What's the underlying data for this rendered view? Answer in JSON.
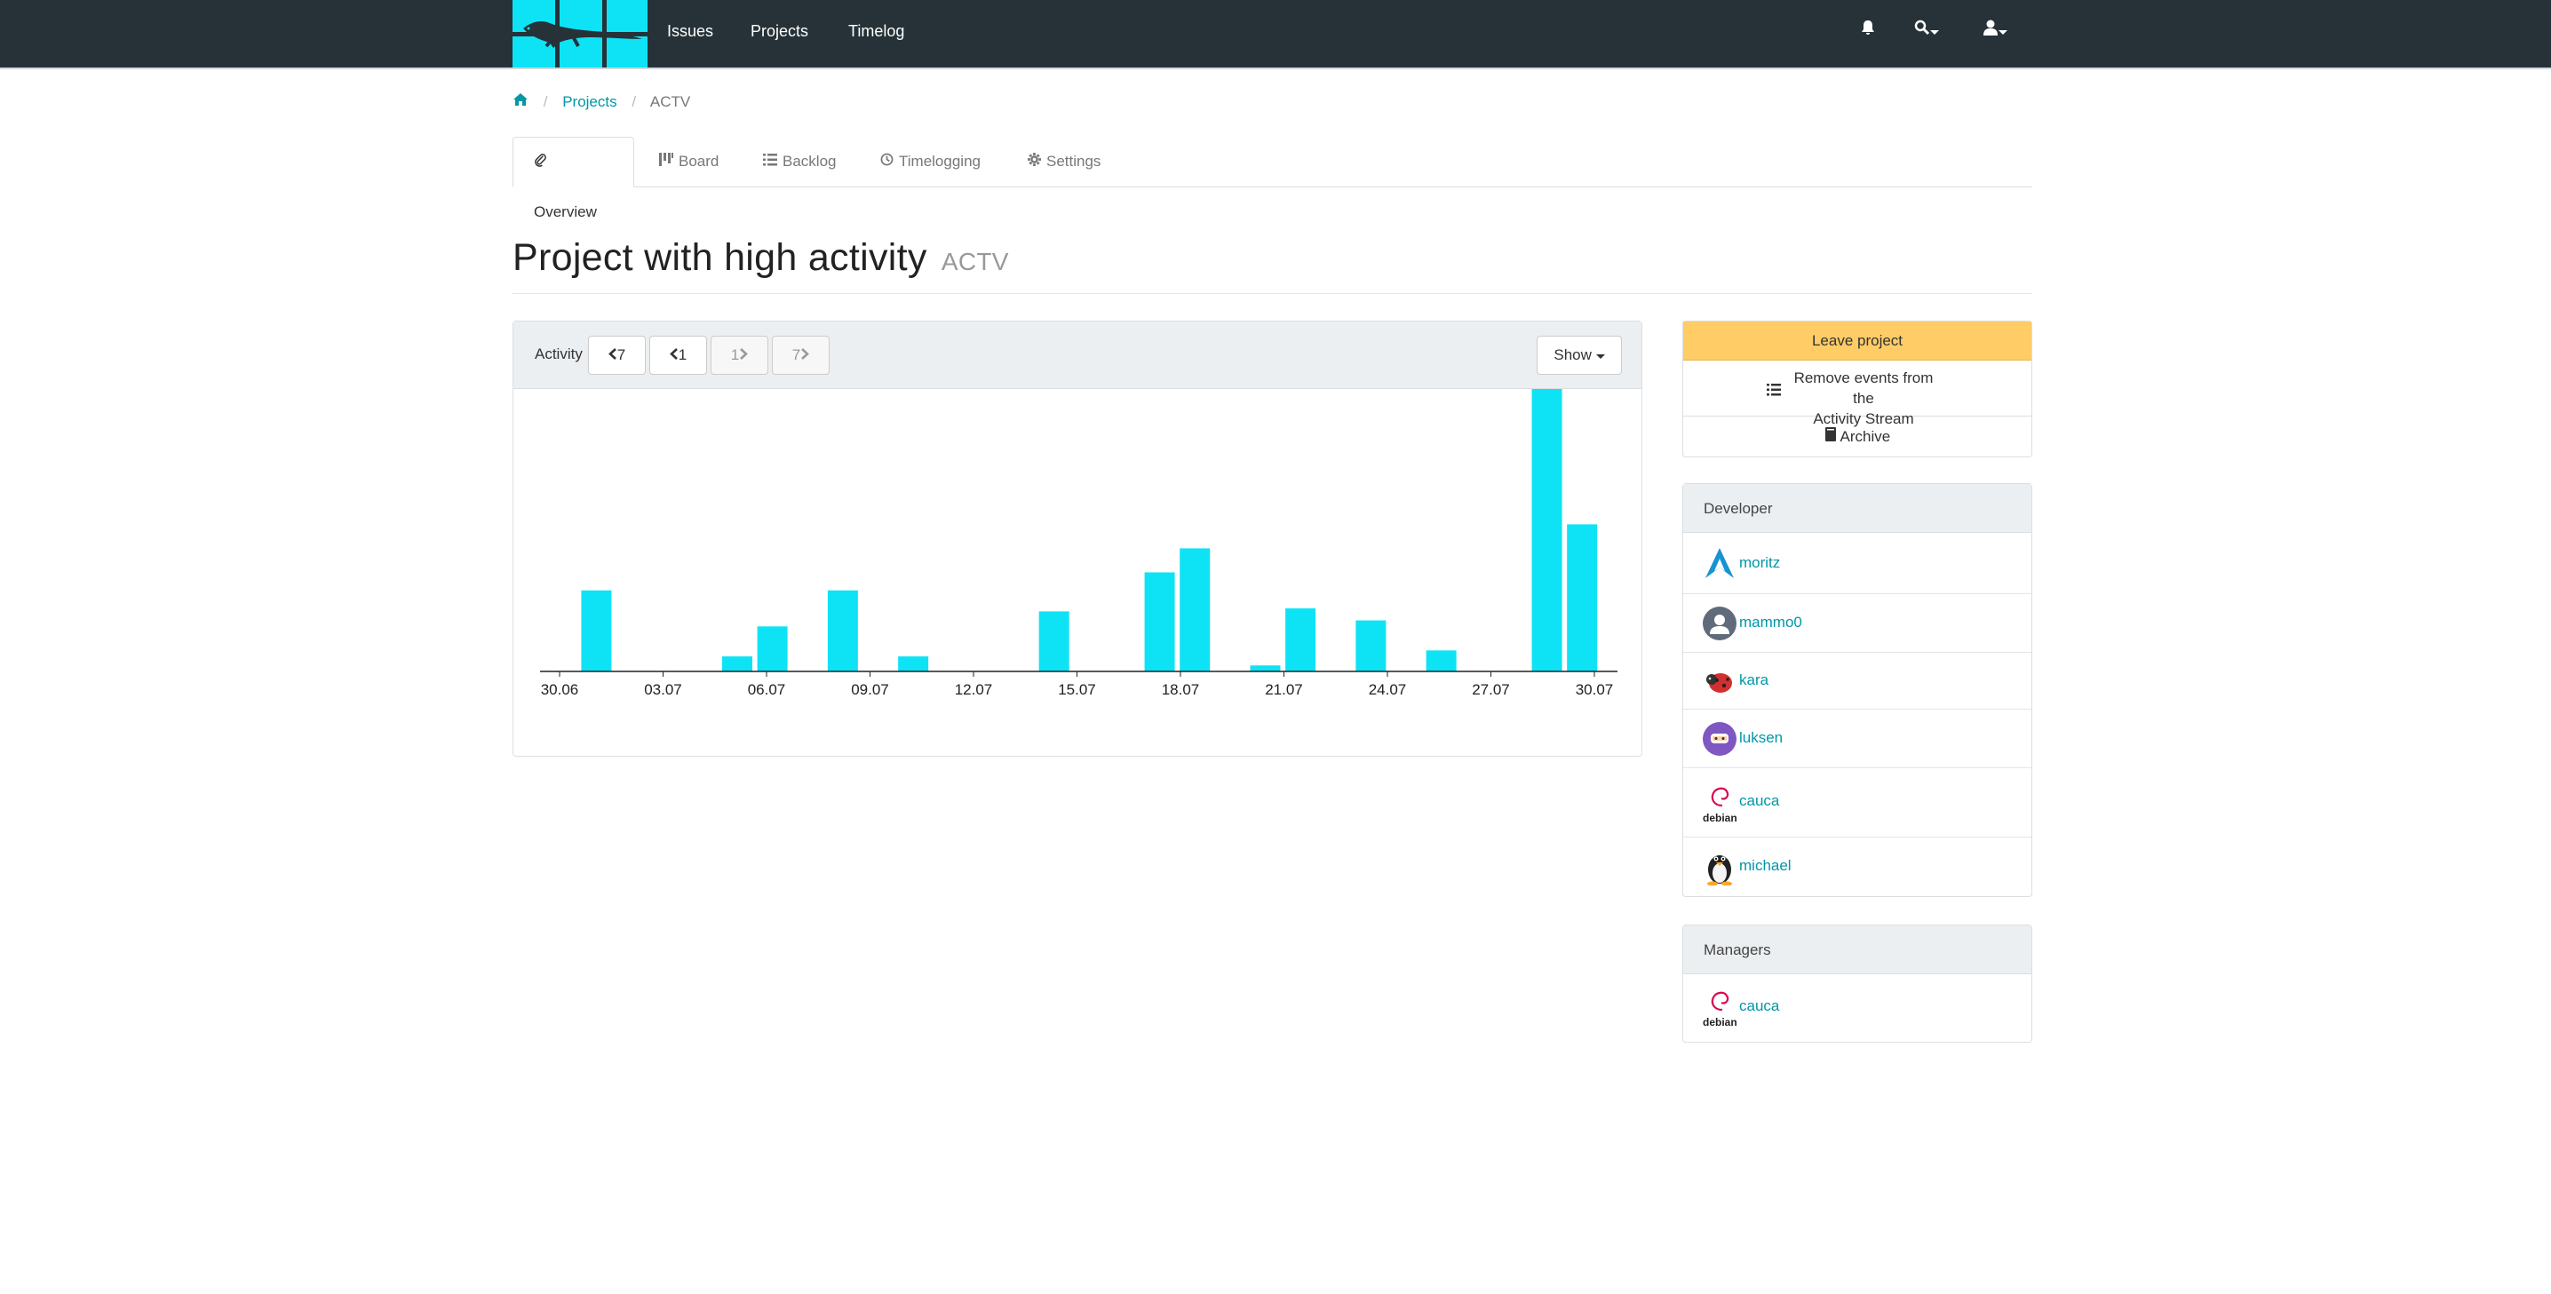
{
  "nav": {
    "links": [
      "Issues",
      "Projects",
      "Timelog"
    ],
    "accent": "#0ee3f6",
    "background": "#263238",
    "icons": [
      "bell-icon",
      "search-icon",
      "user-icon"
    ]
  },
  "breadcrumb": {
    "projects": "Projects",
    "current": "ACTV"
  },
  "tabs": [
    {
      "label": "Overview",
      "icon": "paperclip-icon"
    },
    {
      "label": "Board",
      "icon": "board-icon"
    },
    {
      "label": "Backlog",
      "icon": "list-icon"
    },
    {
      "label": "Timelogging",
      "icon": "clock-icon"
    },
    {
      "label": "Settings",
      "icon": "gear-icon"
    }
  ],
  "project": {
    "title": "Project with high activity",
    "key": "ACTV"
  },
  "activity": {
    "label": "Activity",
    "back7": "7",
    "back1": "1",
    "fwd1": "1",
    "fwd7": "7",
    "show": "Show"
  },
  "chart_data": {
    "type": "bar",
    "color": "#0ee3f6",
    "tick_labels": [
      "30.06",
      "03.07",
      "06.07",
      "09.07",
      "12.07",
      "15.07",
      "18.07",
      "21.07",
      "24.07",
      "27.07",
      "30.07"
    ],
    "x": [
      "30.06",
      "01.07",
      "02.07",
      "03.07",
      "04.07",
      "05.07",
      "06.07",
      "07.07",
      "08.07",
      "09.07",
      "10.07",
      "11.07",
      "12.07",
      "13.07",
      "14.07",
      "15.07",
      "16.07",
      "17.07",
      "18.07",
      "19.07",
      "20.07",
      "21.07",
      "22.07",
      "23.07",
      "24.07",
      "25.07",
      "26.07",
      "27.07",
      "28.07",
      "29.07",
      "30.07"
    ],
    "values": [
      0,
      27,
      0,
      0,
      0,
      5,
      15,
      0,
      27,
      0,
      5,
      0,
      0,
      0,
      20,
      0,
      0,
      33,
      41,
      0,
      2,
      21,
      0,
      17,
      0,
      7,
      0,
      0,
      99,
      49,
      0
    ],
    "ylim": [
      0,
      100
    ],
    "grid": false
  },
  "sidebar": {
    "leave": "Leave project",
    "remove": "Remove events from the Activity Stream",
    "remove_line1": "Remove events from the",
    "remove_line2": "Activity Stream",
    "archive": "Archive",
    "leave_color": "#ffcc66",
    "developer_heading": "Developer",
    "developers": [
      "moritz",
      "mammo0",
      "kara",
      "luksen",
      "cauca",
      "michael"
    ],
    "managers_heading": "Managers",
    "managers": [
      "cauca"
    ],
    "avatar_icons": [
      "arch-linux-icon",
      "default-user-icon",
      "ladybug-icon",
      "ninja-icon",
      "debian-logo-icon",
      "tux-penguin-icon"
    ],
    "debian_text": "debian"
  }
}
